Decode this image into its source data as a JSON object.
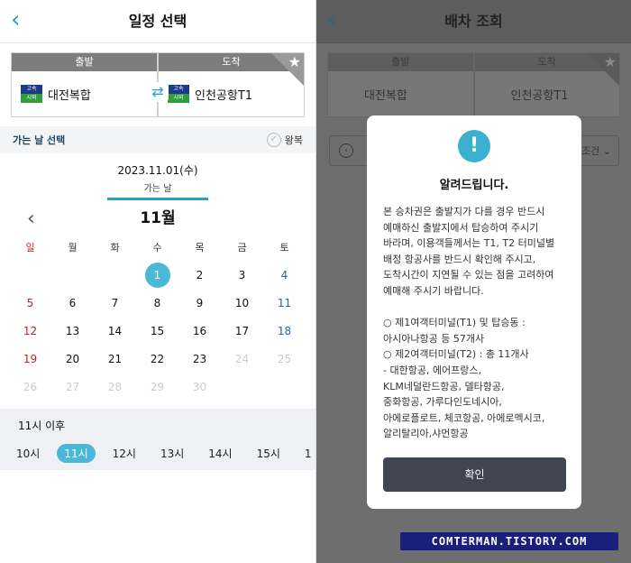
{
  "left": {
    "header": {
      "title": "일정 선택"
    },
    "route": {
      "departure_label": "출발",
      "arrival_label": "도착",
      "badge_top": "고속",
      "badge_bottom": "시외",
      "departure": "대전복합",
      "arrival": "인천공항T1"
    },
    "date_select": {
      "label": "가는 날 선택",
      "roundtrip": "왕복"
    },
    "selected_date": {
      "date": "2023.11.01(수)",
      "sub": "가는 날"
    },
    "calendar": {
      "month": "11월",
      "weekdays": [
        "일",
        "월",
        "화",
        "수",
        "목",
        "금",
        "토"
      ],
      "rows": [
        [
          "",
          "",
          "",
          "1",
          "2",
          "3",
          "4"
        ],
        [
          "5",
          "6",
          "7",
          "8",
          "9",
          "10",
          "11"
        ],
        [
          "12",
          "13",
          "14",
          "15",
          "16",
          "17",
          "18"
        ],
        [
          "19",
          "20",
          "21",
          "22",
          "23",
          "24",
          "25"
        ],
        [
          "26",
          "27",
          "28",
          "29",
          "30",
          "",
          ""
        ]
      ],
      "selected": "1",
      "disabled": [
        "24",
        "25",
        "26",
        "27",
        "28",
        "29",
        "30"
      ]
    },
    "time": {
      "title": "11시 이후",
      "options": [
        "10시",
        "11시",
        "12시",
        "13시",
        "14시",
        "15시",
        "1"
      ],
      "selected": "11시"
    }
  },
  "right": {
    "header": {
      "title": "배차 조회"
    },
    "route": {
      "departure_label": "출발",
      "arrival_label": "도착",
      "departure": "대전복합",
      "arrival": "인천공항T1"
    },
    "filter_partial": "조건",
    "modal": {
      "icon_glyph": "!",
      "title": "알려드립니다.",
      "lines": [
        "본 승차권은 출발지가 다를 경우 반드시",
        "예매하신 출발지에서 탑승하여 주시기",
        "바라며, 이용객들께서는 T1, T2 터미널별",
        "배정 항공사를 반드시 확인해 주시고,",
        "도착시간이 지연될 수 있는 점을 고려하여",
        "예매해 주시기 바랍니다.",
        "",
        "○ 제1여객터미널(T1) 및 탑승동 :",
        "아시아나항공 등 57개사",
        "○ 제2여객터미널(T2) : 총 11개사",
        "- 대한항공, 에어프랑스,",
        "KLM네덜란드항공, 델타항공,",
        "중화항공, 가루다인도네시아,",
        "아에로플로트, 체코항공, 아에로멕시코,",
        "알리탈리아,샤먼항공"
      ],
      "confirm": "확인"
    }
  },
  "watermark": "COMTERMAN.TISTORY.COM",
  "colors": {
    "accent": "#2aa0c8",
    "selected": "#4ab8d6",
    "button_dark": "#3f4652"
  }
}
